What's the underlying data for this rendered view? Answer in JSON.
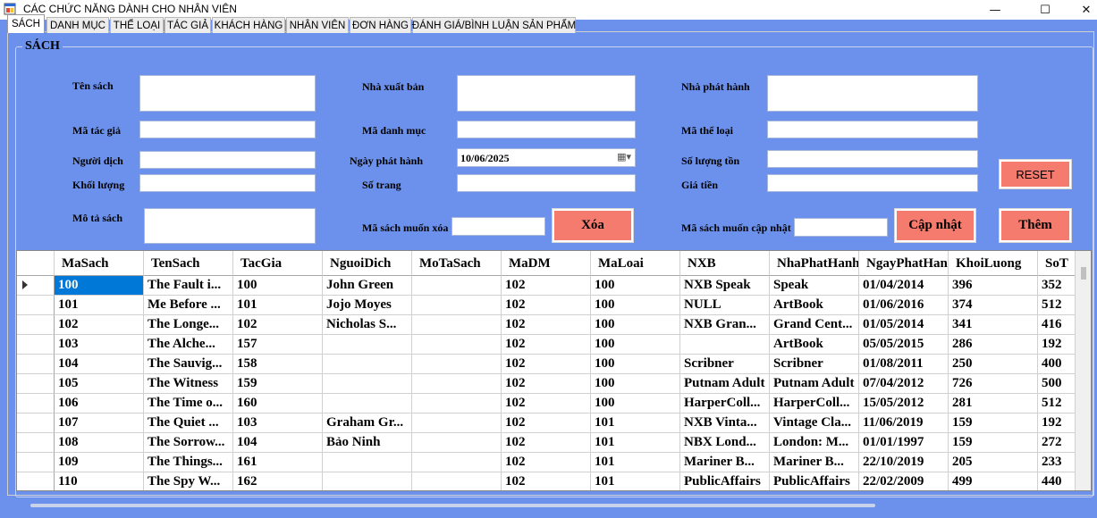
{
  "window": {
    "title": "CÁC CHỨC NĂNG DÀNH CHO NHÂN VIÊN",
    "min_icon": "minimize-icon",
    "max_icon": "maximize-icon",
    "close_icon": "close-icon"
  },
  "tabs": [
    {
      "label": "SÁCH",
      "active": true
    },
    {
      "label": "DANH MỤC",
      "active": false
    },
    {
      "label": "THỂ LOẠI",
      "active": false
    },
    {
      "label": "TÁC GIẢ",
      "active": false
    },
    {
      "label": "KHÁCH HÀNG",
      "active": false
    },
    {
      "label": "NHÂN VIÊN",
      "active": false
    },
    {
      "label": "ĐƠN HÀNG",
      "active": false
    },
    {
      "label": "ĐÁNH GIÁ/BÌNH LUẬN SẢN PHẨM",
      "active": false
    }
  ],
  "form": {
    "group_title": "SÁCH",
    "labels": {
      "ten_sach": "Tên sách",
      "ma_tac_gia": "Mã tác giả",
      "nguoi_dich": "Người dịch",
      "khoi_luong": "Khối lượng",
      "mo_ta_sach": "Mô tả sách",
      "nha_xuat_ban": "Nhà xuất bản",
      "ma_danh_muc": "Mã danh mục",
      "ngay_phat_hanh": "Ngày phát hành",
      "so_trang": "Số trang",
      "ma_sach_muon_xoa": "Mã sách muốn xóa",
      "nha_phat_hanh": "Nhà phát hành",
      "ma_the_loai": "Mã thể loại",
      "so_luong_ton": "Số lượng tồn",
      "gia_tien": "Giá tiền",
      "ma_sach_muon_cap_nhat": "Mã sách muốn cập nhật"
    },
    "date_value": "10/06/2025",
    "date_icon": "calendar-dropdown-icon",
    "buttons": {
      "reset": "RESET",
      "xoa": "Xóa",
      "cap_nhat": "Cập nhật",
      "them": "Thêm"
    }
  },
  "grid": {
    "columns": [
      "MaSach",
      "TenSach",
      "TacGia",
      "NguoiDich",
      "MoTaSach",
      "MaDM",
      "MaLoai",
      "NXB",
      "NhaPhatHanh",
      "NgayPhatHanh",
      "KhoiLuong",
      "SoT"
    ],
    "rows": [
      [
        "100",
        "The Fault i...",
        "100",
        "John Green",
        "",
        "102",
        "100",
        "NXB Speak",
        "Speak",
        "01/04/2014",
        "396",
        "352"
      ],
      [
        "101",
        "Me Before ...",
        "101",
        "Jojo Moyes",
        "",
        "102",
        "100",
        "NULL",
        "ArtBook",
        "01/06/2016",
        "374",
        "512"
      ],
      [
        "102",
        "The Longe...",
        "102",
        "Nicholas S...",
        "",
        "102",
        "100",
        "NXB Gran...",
        "Grand Cent...",
        "01/05/2014",
        "341",
        "416"
      ],
      [
        "103",
        "The Alche...",
        "157",
        "",
        "",
        "102",
        "100",
        "",
        "ArtBook",
        "05/05/2015",
        "286",
        "192"
      ],
      [
        "104",
        "The Sauvig...",
        "158",
        "",
        "",
        "102",
        "100",
        "Scribner",
        "Scribner",
        "01/08/2011",
        "250",
        "400"
      ],
      [
        "105",
        "The Witness",
        "159",
        "",
        "",
        "102",
        "100",
        "Putnam Adult",
        "Putnam Adult",
        "07/04/2012",
        "726",
        "500"
      ],
      [
        "106",
        "The Time o...",
        "160",
        "",
        "",
        "102",
        "100",
        "HarperColl...",
        "HarperColl...",
        "15/05/2012",
        "281",
        "512"
      ],
      [
        "107",
        "The Quiet ...",
        "103",
        "Graham Gr...",
        "",
        "102",
        "101",
        "NXB Vinta...",
        "Vintage Cla...",
        "11/06/2019",
        "159",
        "192"
      ],
      [
        "108",
        "The Sorrow...",
        "104",
        "Bảo Ninh",
        "",
        "102",
        "101",
        "NBX Lond...",
        "London: M...",
        "01/01/1997",
        "159",
        "272"
      ],
      [
        "109",
        "The Things...",
        "161",
        "",
        "",
        "102",
        "101",
        "Mariner B...",
        "Mariner B...",
        "22/10/2019",
        "205",
        "233"
      ],
      [
        "110",
        "The Spy W...",
        "162",
        "",
        "",
        "102",
        "101",
        "PublicAffairs",
        "PublicAffairs",
        "22/02/2009",
        "499",
        "440"
      ]
    ]
  },
  "colors": {
    "background": "#6b91ec",
    "button": "#f47b6d",
    "selection": "#0078d7"
  }
}
